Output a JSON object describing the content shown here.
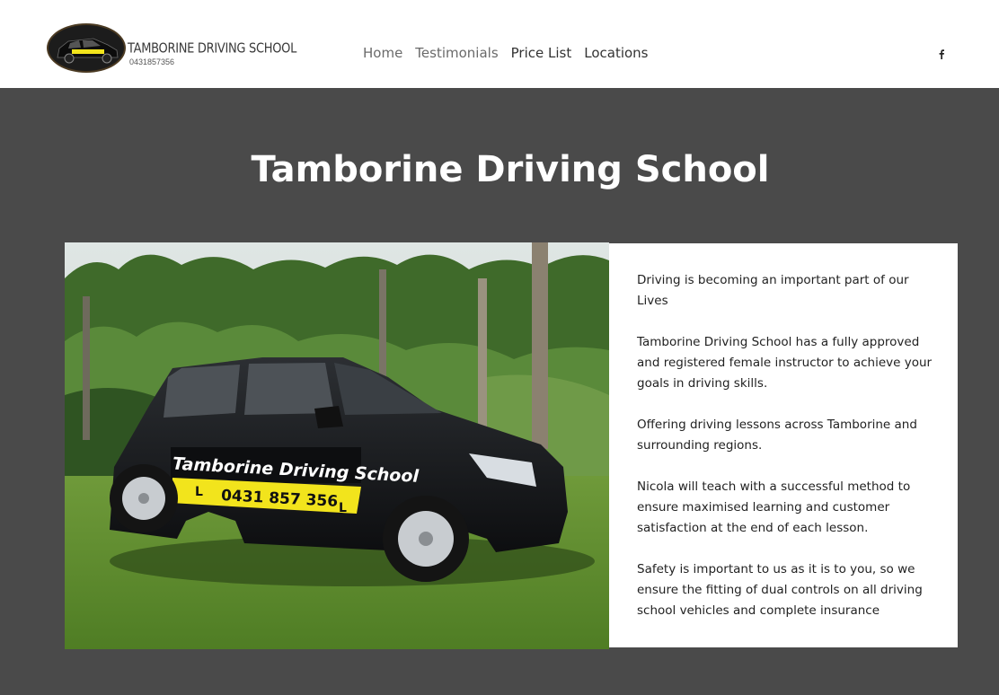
{
  "header": {
    "brand_name": "TAMBORINE DRIVING SCHOOL",
    "brand_phone": "0431857356",
    "nav": [
      {
        "label": "Home"
      },
      {
        "label": "Testimonials"
      },
      {
        "label": "Price List"
      },
      {
        "label": "Locations"
      }
    ],
    "social": [
      {
        "icon": "facebook-icon"
      }
    ]
  },
  "main": {
    "title": "Tamborine Driving School",
    "car_signage": {
      "name": "Tamborine Driving School",
      "phone": "0431 857 356",
      "plate_letter": "L"
    },
    "paragraphs": [
      "Driving is becoming an important part of our Lives",
      "Tamborine Driving School has a fully approved and registered female instructor to achieve your goals in driving skills.",
      "Offering driving lessons across Tamborine and surrounding regions.",
      "Nicola will teach with a successful method to ensure maximised learning and customer satisfaction at the end of each lesson.",
      "Safety is important to us as it is to you, so we ensure the fitting of dual controls on all driving school vehicles and complete insurance"
    ]
  },
  "colors": {
    "main_background": "#4a4a4a",
    "header_background": "#ffffff",
    "signage_yellow": "#f2e41c",
    "text_dark": "#222222"
  }
}
